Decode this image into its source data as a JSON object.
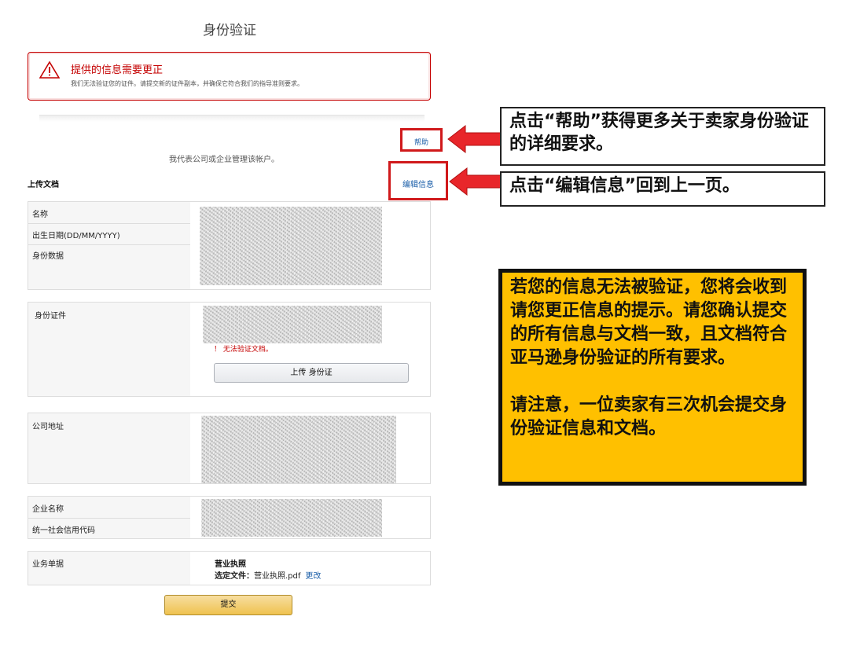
{
  "page": {
    "title": "身份验证",
    "rep_text": "我代表公司或企业管理该帐户。",
    "upload_heading": "上传文档"
  },
  "alert": {
    "title": "提供的信息需要更正",
    "description": "我们无法验证您的证件。请提交新的证件副本，并确保它符合我们的指导准则要求。",
    "icon": "warning-icon",
    "color": "#c40000"
  },
  "links": {
    "help": "帮助",
    "edit": "编辑信息"
  },
  "sections": {
    "identity": {
      "labels": [
        "名称",
        "出生日期(DD/MM/YYYY)",
        "身份数据"
      ]
    },
    "id_document": {
      "label": "身份证件",
      "error": "！ 无法验证文档。",
      "upload_button": "上传 身份证"
    },
    "company_address": {
      "label": "公司地址"
    },
    "company": {
      "labels": [
        "企业名称",
        "统一社会信用代码"
      ]
    },
    "business_docs": {
      "label": "业务单据",
      "doc_title": "营业执照",
      "file_prefix": "选定文件：",
      "file_name": "营业执照.pdf",
      "change_link": "更改"
    }
  },
  "buttons": {
    "submit": "提交"
  },
  "annotations": {
    "callout_help": "点击“帮助”获得更多关于卖家身份验证的详细要求。",
    "callout_edit": "点击“编辑信息”回到上一页。",
    "note_para1": "若您的信息无法被验证，您将会收到请您更正信息的提示。请您确认提交的所有信息与文档一致，且文档符合亚马逊身份验证的所有要求。",
    "note_para2": "请注意，一位卖家有三次机会提交身份验证信息和文档。",
    "highlight_color": "#d0191b",
    "note_color": "#ffc000"
  }
}
